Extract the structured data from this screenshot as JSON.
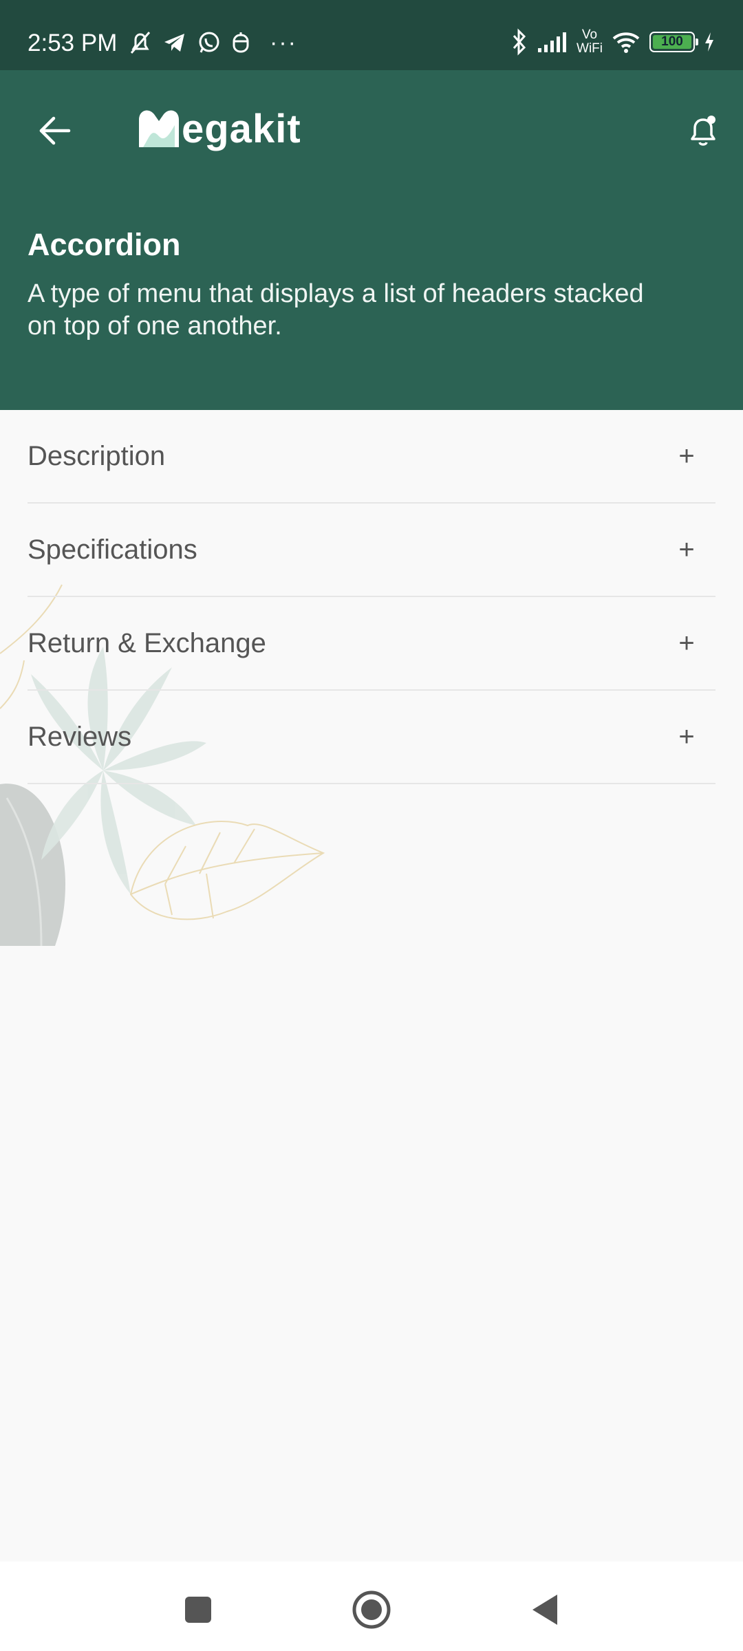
{
  "status_bar": {
    "time": "2:53 PM",
    "icons_left": [
      "mute-icon",
      "telegram-icon",
      "whatsapp-icon",
      "app-icon",
      "more-dots-icon"
    ],
    "icons_right": [
      "bluetooth-icon",
      "signal-icon",
      "vowifi-icon",
      "wifi-icon",
      "battery-icon",
      "charging-icon"
    ],
    "vowifi_label_top": "Vo",
    "vowifi_label_bottom": "WiFi",
    "battery": "100",
    "more": "···"
  },
  "header": {
    "logo_text": "egakit",
    "title": "Accordion",
    "description": "A type of menu that displays a list of headers stacked on top of one another.",
    "bg_color": "#2c6354"
  },
  "accordion": {
    "items": [
      {
        "label": "Description",
        "toggle": "+"
      },
      {
        "label": "Specifications",
        "toggle": "+"
      },
      {
        "label": "Return & Exchange",
        "toggle": "+"
      },
      {
        "label": "Reviews",
        "toggle": "+"
      }
    ]
  },
  "nav_bar": {
    "buttons": [
      "recent-apps-icon",
      "home-icon",
      "back-triangle-icon"
    ]
  }
}
